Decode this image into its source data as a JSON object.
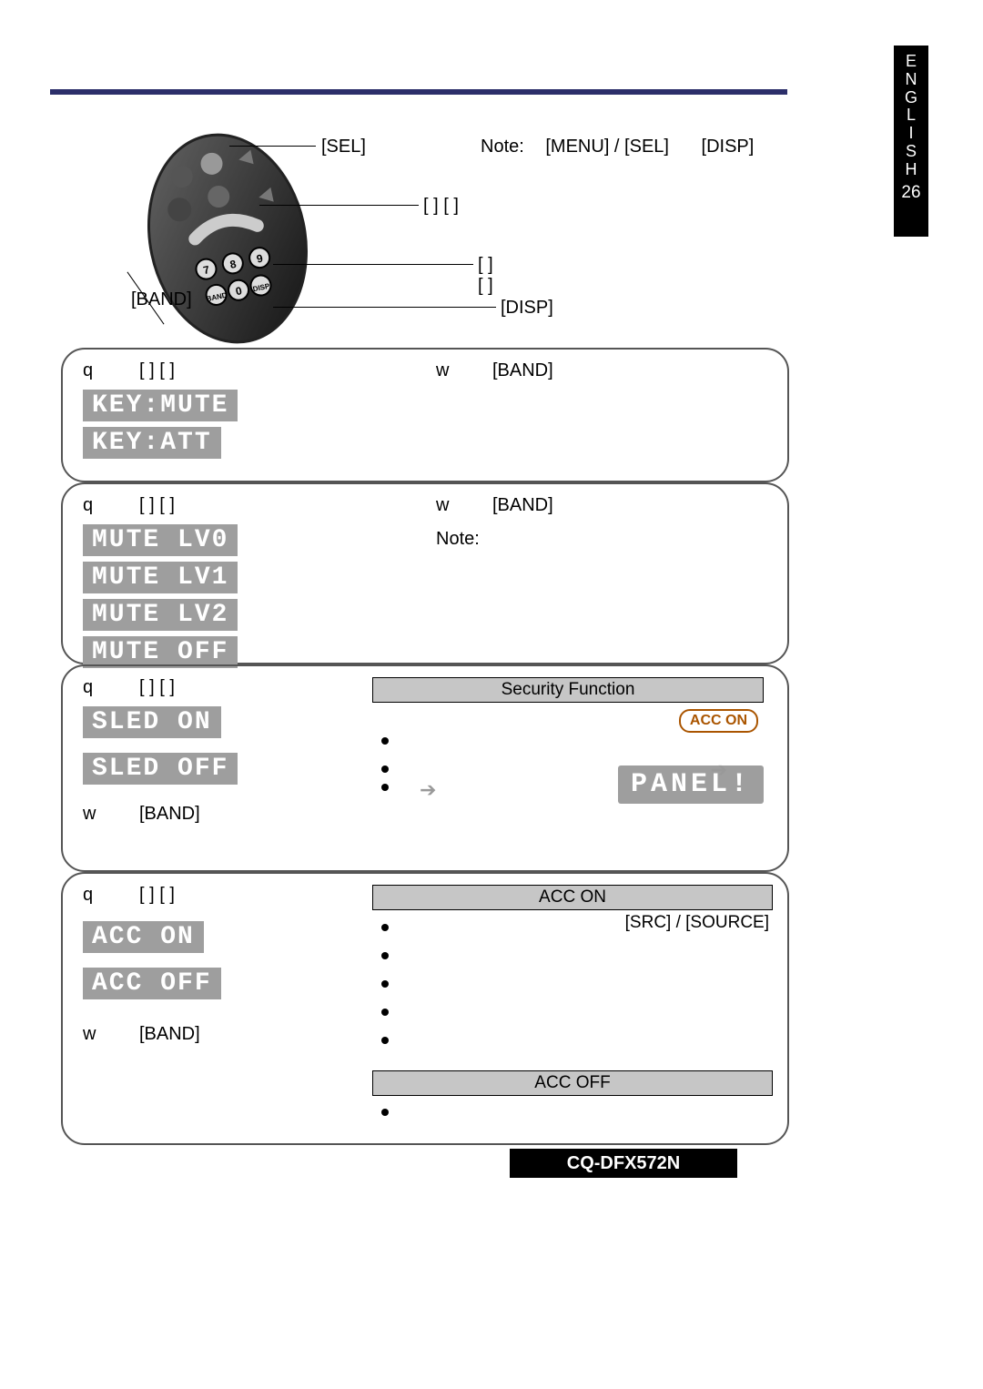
{
  "tab": {
    "language": "ENGLISH",
    "page": "26"
  },
  "topnote": {
    "note": "Note:",
    "menu_sel": "[MENU] / [SEL]",
    "disp": "[DISP]"
  },
  "remote_callouts": {
    "sel": "[SEL]",
    "row1": "[   ] [   ]",
    "row2": "[   ] [   ]",
    "disp": "[DISP]",
    "band": "[BAND]"
  },
  "sec_common": {
    "q": "q",
    "w": "w",
    "brackets": "[   ]   [   ]",
    "band": "[BAND]"
  },
  "sec1": {
    "disp1": "KEY:MUTE",
    "disp2": "KEY:ATT "
  },
  "sec2": {
    "disp1": "MUTE LV0",
    "disp2": "MUTE LV1",
    "disp3": "MUTE LV2",
    "disp4": "MUTE OFF",
    "note": "Note:"
  },
  "sec3": {
    "disp_on": "SLED ON ",
    "disp_off": "SLED OFF",
    "right_header": "Security Function",
    "acc_on": "ACC ON",
    "panel": "PANEL!"
  },
  "sec4": {
    "disp_on": "ACC ON ",
    "disp_off": "ACC OFF",
    "right_header_on": "ACC ON",
    "src_source": "[SRC] / [SOURCE]",
    "right_header_off": "ACC OFF"
  },
  "footer": {
    "model": "CQ-DFX572N"
  }
}
